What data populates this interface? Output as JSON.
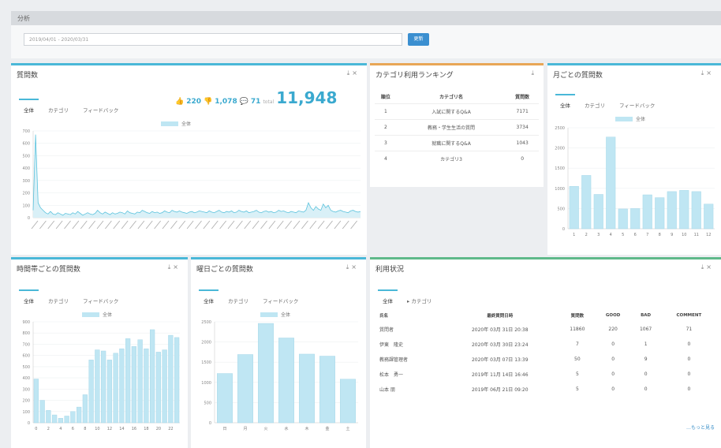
{
  "header": {
    "title": "分析"
  },
  "filter": {
    "date_range": "2019/04/01 - 2020/03/31",
    "apply_label": "更新"
  },
  "panels": {
    "questions": {
      "title": "質問数",
      "tabs": [
        "全体",
        "カテゴリ",
        "フィードバック"
      ],
      "good": "220",
      "bad": "1,078",
      "comment": "71",
      "total_label": "total",
      "total": "11,948",
      "legend": "全体"
    },
    "ranking": {
      "title": "カテゴリ利用ランキング",
      "columns": [
        "順位",
        "カテゴリ名",
        "質問数"
      ],
      "rows": [
        [
          "1",
          "入試に関するQ&A",
          "7171"
        ],
        [
          "2",
          "教務・学生生活の質問",
          "3734"
        ],
        [
          "3",
          "就職に関するQ&A",
          "1043"
        ],
        [
          "4",
          "カテゴリ3",
          "0"
        ]
      ]
    },
    "monthly": {
      "title": "月ごとの質問数",
      "tabs": [
        "全体",
        "カテゴリ",
        "フィードバック"
      ],
      "legend": "全体"
    },
    "hourly": {
      "title": "時間帯ごとの質問数",
      "tabs": [
        "全体",
        "カテゴリ",
        "フィードバック"
      ],
      "legend": "全体"
    },
    "weekday": {
      "title": "曜日ごとの質問数",
      "tabs": [
        "全体",
        "カテゴリ",
        "フィードバック"
      ],
      "legend": "全体"
    },
    "usage": {
      "title": "利用状況",
      "tabs": [
        "全体",
        "カテゴリ"
      ],
      "columns": [
        "氏名",
        "最終質問日時",
        "質問数",
        "GOOD",
        "BAD",
        "COMMENT"
      ],
      "rows": [
        [
          "質問者",
          "2020年 03月 31日  20:38",
          "11860",
          "220",
          "1067",
          "71"
        ],
        [
          "伊東　隆史",
          "2020年 03月 30日  23:24",
          "7",
          "0",
          "1",
          "0"
        ],
        [
          "教務課管理者",
          "2020年 03月 07日  13:39",
          "50",
          "0",
          "9",
          "0"
        ],
        [
          "松本　勇一",
          "2019年 11月 14日  16:46",
          "5",
          "0",
          "0",
          "0"
        ],
        [
          "山本 朋",
          "2019年 06月 21日  09:20",
          "5",
          "0",
          "0",
          "0"
        ]
      ],
      "more_label": "…もっと見る"
    }
  },
  "colors": {
    "bar": "#bfe6f3",
    "accent": "#3aa9cf",
    "line": "#5cc3dd"
  },
  "chart_data": [
    {
      "type": "line",
      "title": "質問数",
      "series": [
        {
          "name": "全体"
        }
      ],
      "yticks": [
        0,
        100,
        200,
        300,
        400,
        500,
        600,
        700
      ],
      "ylim": [
        0,
        700
      ],
      "values": [
        60,
        670,
        120,
        80,
        60,
        40,
        30,
        50,
        30,
        25,
        40,
        30,
        20,
        35,
        30,
        25,
        40,
        30,
        50,
        35,
        20,
        30,
        40,
        30,
        25,
        35,
        60,
        40,
        30,
        45,
        35,
        25,
        40,
        30,
        35,
        45,
        40,
        30,
        55,
        40,
        35,
        30,
        45,
        40,
        60,
        50,
        40,
        35,
        50,
        40,
        45,
        35,
        40,
        55,
        45,
        40,
        60,
        50,
        45,
        55,
        45,
        40,
        35,
        45,
        50,
        40,
        45,
        55,
        50,
        45,
        40,
        55,
        45,
        40,
        50,
        60,
        45,
        40,
        50,
        45,
        55,
        40,
        45,
        60,
        50,
        45,
        55,
        40,
        45,
        50,
        60,
        45,
        40,
        50,
        55,
        45,
        50,
        40,
        45,
        60,
        50,
        55,
        45,
        40,
        50,
        45,
        40,
        55,
        50,
        45,
        60,
        120,
        80,
        60,
        90,
        70,
        60,
        110,
        80,
        100,
        60,
        50,
        45,
        55,
        60,
        50,
        45,
        40,
        55,
        60,
        50,
        45,
        50
      ]
    },
    {
      "type": "bar",
      "title": "月ごとの質問数",
      "categories": [
        "1",
        "2",
        "3",
        "4",
        "5",
        "6",
        "7",
        "8",
        "9",
        "10",
        "11",
        "12"
      ],
      "values": [
        1050,
        1320,
        850,
        2270,
        490,
        500,
        840,
        770,
        920,
        950,
        920,
        610
      ],
      "yticks": [
        0,
        500,
        1000,
        1500,
        2000,
        2500
      ],
      "ylim": [
        0,
        2500
      ]
    },
    {
      "type": "bar",
      "title": "時間帯ごとの質問数",
      "categories": [
        "0",
        "1",
        "2",
        "3",
        "4",
        "5",
        "6",
        "7",
        "8",
        "9",
        "10",
        "11",
        "12",
        "13",
        "14",
        "15",
        "16",
        "17",
        "18",
        "19",
        "20",
        "21",
        "22",
        "23"
      ],
      "xticks": [
        "0",
        "2",
        "4",
        "6",
        "8",
        "10",
        "12",
        "14",
        "16",
        "18",
        "20",
        "22"
      ],
      "values": [
        390,
        200,
        110,
        70,
        40,
        60,
        100,
        140,
        250,
        560,
        650,
        640,
        560,
        620,
        660,
        750,
        680,
        740,
        660,
        830,
        630,
        650,
        780,
        760
      ],
      "yticks": [
        0,
        100,
        200,
        300,
        400,
        500,
        600,
        700,
        800,
        900
      ],
      "ylim": [
        0,
        900
      ]
    },
    {
      "type": "bar",
      "title": "曜日ごとの質問数",
      "categories": [
        "日",
        "月",
        "火",
        "水",
        "木",
        "金",
        "土"
      ],
      "values": [
        1220,
        1690,
        2460,
        2100,
        1700,
        1650,
        1080
      ],
      "yticks": [
        0,
        500,
        1000,
        1500,
        2000,
        2500
      ],
      "ylim": [
        0,
        2500
      ]
    }
  ]
}
